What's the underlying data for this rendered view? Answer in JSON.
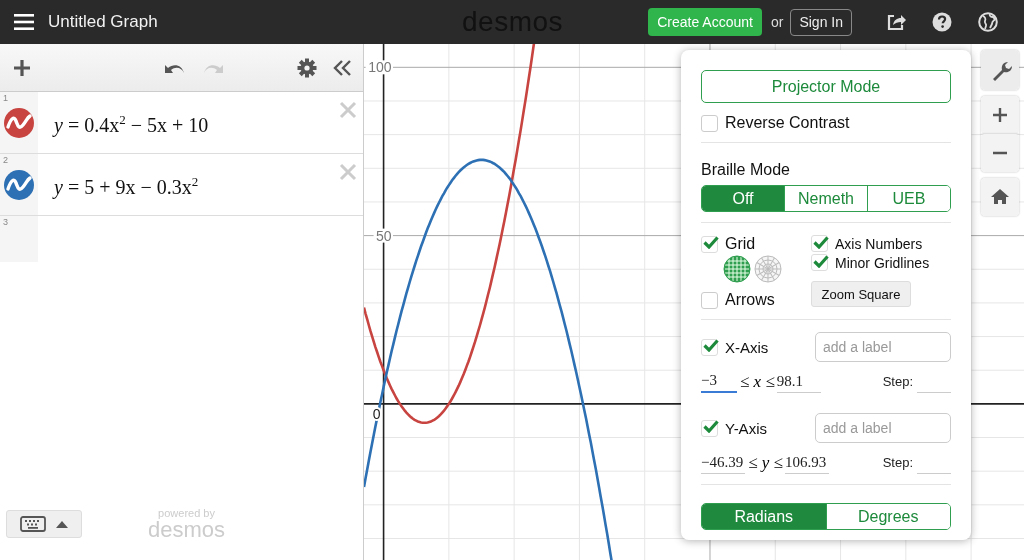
{
  "header": {
    "title": "Untitled Graph",
    "logo": "desmos",
    "create_account": "Create Account",
    "or": "or",
    "sign_in": "Sign In"
  },
  "expression_list": {
    "items": [
      {
        "number": "1",
        "color": "#c74440",
        "formula": "*y* = 0.4x$^{2}$ − 5x + 10"
      },
      {
        "number": "2",
        "color": "#2d70b3",
        "formula": "*y* = 5 + 9x − 0.3x$^{2}$"
      },
      {
        "number": "3"
      }
    ]
  },
  "footer": {
    "powered_by": "powered by",
    "brand": "desmos"
  },
  "graph": {
    "y_labels": [
      "100",
      "50"
    ],
    "origin_label": "0"
  },
  "settings": {
    "projector_mode": "Projector Mode",
    "reverse_contrast": {
      "label": "Reverse Contrast",
      "checked": false
    },
    "braille": {
      "title": "Braille Mode",
      "options": [
        {
          "label": "Off",
          "selected": true
        },
        {
          "label": "Nemeth",
          "selected": false
        },
        {
          "label": "UEB",
          "selected": false
        }
      ]
    },
    "grid": {
      "label": "Grid",
      "checked": true
    },
    "grid_types": [
      {
        "kind": "cartesian",
        "selected": true
      },
      {
        "kind": "polar",
        "selected": false
      }
    ],
    "arrows": {
      "label": "Arrows",
      "checked": false
    },
    "axis_numbers": {
      "label": "Axis Numbers",
      "checked": true
    },
    "minor_gridlines": {
      "label": "Minor Gridlines",
      "checked": true
    },
    "zoom_square": "Zoom Square",
    "axes": [
      {
        "label": "X-Axis",
        "checked": true,
        "placeholder": "add a label",
        "min": {
          "value": "−3",
          "focused": true
        },
        "relation": "≤ *x* ≤",
        "max": {
          "value": "98.1",
          "focused": false
        },
        "step_label": "Step:"
      },
      {
        "label": "Y-Axis",
        "checked": true,
        "placeholder": "add a label",
        "min": {
          "value": "−46.39",
          "focused": false
        },
        "relation": "≤ *y* ≤",
        "max": {
          "value": "106.93",
          "focused": false
        },
        "step_label": "Step:"
      }
    ],
    "angle_units": [
      {
        "label": "Radians",
        "selected": true
      },
      {
        "label": "Degrees",
        "selected": false
      }
    ]
  }
}
